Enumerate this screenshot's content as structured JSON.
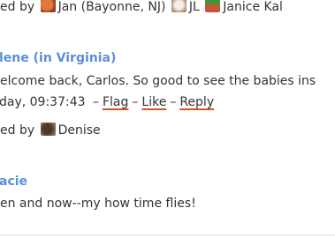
{
  "liked_row_1": {
    "prefix": "ed by",
    "users": [
      {
        "name": "Jan (Bayonne, NJ)",
        "avatar": "orange-avatar"
      },
      {
        "name": "JL",
        "avatar": "white-dog-avatar"
      },
      {
        "name": "Janice Kal",
        "avatar": "landscape-avatar"
      }
    ]
  },
  "comment_1": {
    "author": "lene (in Virginia)",
    "body": "elcome back, Carlos.  So good to see the babies ins",
    "timestamp": "day, 09:37:43",
    "actions": {
      "flag": "Flag",
      "like": "Like",
      "reply": "Reply",
      "separator": "–"
    }
  },
  "liked_row_2": {
    "prefix": "ed by",
    "users": [
      {
        "name": "Denise",
        "avatar": "brown-avatar"
      }
    ]
  },
  "comment_2": {
    "author": "acie",
    "body": "en and now--my how time flies!"
  },
  "colors": {
    "author": "#5c8fd6",
    "text": "#333333",
    "link_underline": "#d9531e"
  }
}
